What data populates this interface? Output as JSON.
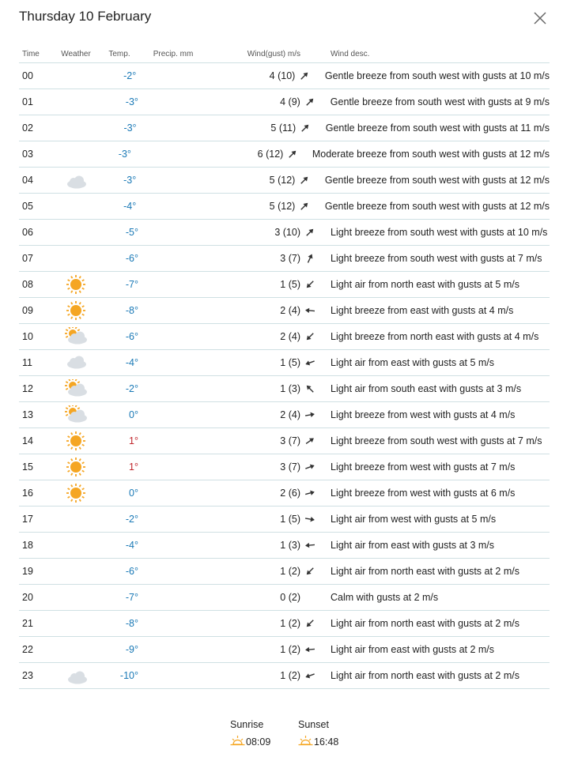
{
  "title": "Thursday 10 February",
  "headers": {
    "time": "Time",
    "weather": "Weather",
    "temp": "Temp.",
    "precip": "Precip. mm",
    "wind": "Wind(gust) m/s",
    "desc": "Wind desc."
  },
  "rows": [
    {
      "time": "00",
      "icon": "moon-icon",
      "temp": "-2°",
      "wind": "4 (10)",
      "arrow_deg": 45,
      "desc": "Gentle breeze from south west with gusts at 10 m/s"
    },
    {
      "time": "01",
      "icon": "moon-icon",
      "temp": "-3°",
      "wind": "4 (9)",
      "arrow_deg": 45,
      "desc": "Gentle breeze from south west with gusts at 9 m/s"
    },
    {
      "time": "02",
      "icon": "moon-icon",
      "temp": "-3°",
      "wind": "5 (11)",
      "arrow_deg": 45,
      "desc": "Gentle breeze from south west with gusts at 11 m/s"
    },
    {
      "time": "03",
      "icon": "moon-icon",
      "temp": "-3°",
      "wind": "6 (12)",
      "arrow_deg": 45,
      "desc": "Moderate breeze from south west with gusts at 12 m/s"
    },
    {
      "time": "04",
      "icon": "moon-cloud-icon",
      "temp": "-3°",
      "wind": "5 (12)",
      "arrow_deg": 45,
      "desc": "Gentle breeze from south west with gusts at 12 m/s"
    },
    {
      "time": "05",
      "icon": "moon-icon",
      "temp": "-4°",
      "wind": "5 (12)",
      "arrow_deg": 45,
      "desc": "Gentle breeze from south west with gusts at 12 m/s"
    },
    {
      "time": "06",
      "icon": "moon-icon",
      "temp": "-5°",
      "wind": "3 (10)",
      "arrow_deg": 45,
      "desc": "Light breeze from south west with gusts at 10 m/s"
    },
    {
      "time": "07",
      "icon": "moon-icon",
      "temp": "-6°",
      "wind": "3 (7)",
      "arrow_deg": 25,
      "desc": "Light breeze from south west with gusts at 7 m/s"
    },
    {
      "time": "08",
      "icon": "sun-icon",
      "temp": "-7°",
      "wind": "1 (5)",
      "arrow_deg": 225,
      "desc": "Light air from north east with gusts at 5 m/s"
    },
    {
      "time": "09",
      "icon": "sun-icon",
      "temp": "-8°",
      "wind": "2 (4)",
      "arrow_deg": 275,
      "desc": "Light breeze from east with gusts at 4 m/s"
    },
    {
      "time": "10",
      "icon": "sun-cloud-icon",
      "temp": "-6°",
      "wind": "2 (4)",
      "arrow_deg": 225,
      "desc": "Light breeze from north east with gusts at 4 m/s"
    },
    {
      "time": "11",
      "icon": "cloud-icon",
      "temp": "-4°",
      "wind": "1 (5)",
      "arrow_deg": 250,
      "desc": "Light air from east with gusts at 5 m/s"
    },
    {
      "time": "12",
      "icon": "sun-cloud-icon",
      "temp": "-2°",
      "wind": "1 (3)",
      "arrow_deg": 315,
      "desc": "Light air from south east with gusts at 3 m/s"
    },
    {
      "time": "13",
      "icon": "sun-cloud-icon",
      "temp": "0°",
      "wind": "2 (4)",
      "arrow_deg": 80,
      "desc": "Light breeze from west with gusts at 4 m/s"
    },
    {
      "time": "14",
      "icon": "sun-icon",
      "temp": "1°",
      "wind": "3 (7)",
      "arrow_deg": 55,
      "desc": "Light breeze from south west with gusts at 7 m/s"
    },
    {
      "time": "15",
      "icon": "sun-icon",
      "temp": "1°",
      "wind": "3 (7)",
      "arrow_deg": 70,
      "desc": "Light breeze from west with gusts at 7 m/s"
    },
    {
      "time": "16",
      "icon": "sun-icon",
      "temp": "0°",
      "wind": "2 (6)",
      "arrow_deg": 75,
      "desc": "Light breeze from west with gusts at 6 m/s"
    },
    {
      "time": "17",
      "icon": "moon-icon",
      "temp": "-2°",
      "wind": "1 (5)",
      "arrow_deg": 100,
      "desc": "Light air from west with gusts at 5 m/s"
    },
    {
      "time": "18",
      "icon": "moon-icon",
      "temp": "-4°",
      "wind": "1 (3)",
      "arrow_deg": 265,
      "desc": "Light air from east with gusts at 3 m/s"
    },
    {
      "time": "19",
      "icon": "moon-icon",
      "temp": "-6°",
      "wind": "1 (2)",
      "arrow_deg": 225,
      "desc": "Light air from north east with gusts at 2 m/s"
    },
    {
      "time": "20",
      "icon": "moon-icon",
      "temp": "-7°",
      "wind": "0 (2)",
      "arrow_deg": null,
      "desc": "Calm with gusts at 2 m/s"
    },
    {
      "time": "21",
      "icon": "moon-icon",
      "temp": "-8°",
      "wind": "1 (2)",
      "arrow_deg": 225,
      "desc": "Light air from north east with gusts at 2 m/s"
    },
    {
      "time": "22",
      "icon": "moon-icon",
      "temp": "-9°",
      "wind": "1 (2)",
      "arrow_deg": 265,
      "desc": "Light air from east with gusts at 2 m/s"
    },
    {
      "time": "23",
      "icon": "moon-cloud-icon",
      "temp": "-10°",
      "wind": "1 (2)",
      "arrow_deg": 250,
      "desc": "Light air from north east with gusts at 2 m/s"
    }
  ],
  "sunrise": {
    "label": "Sunrise",
    "time": "08:09"
  },
  "sunset": {
    "label": "Sunset",
    "time": "16:48"
  },
  "colors": {
    "temp_negative": "#1a79b6",
    "temp_positive": "#c0272d",
    "row_border": "#cfe0e3",
    "sun": "#f5a623",
    "moon": "#4a4a4a",
    "cloud": "#d8dde2"
  }
}
